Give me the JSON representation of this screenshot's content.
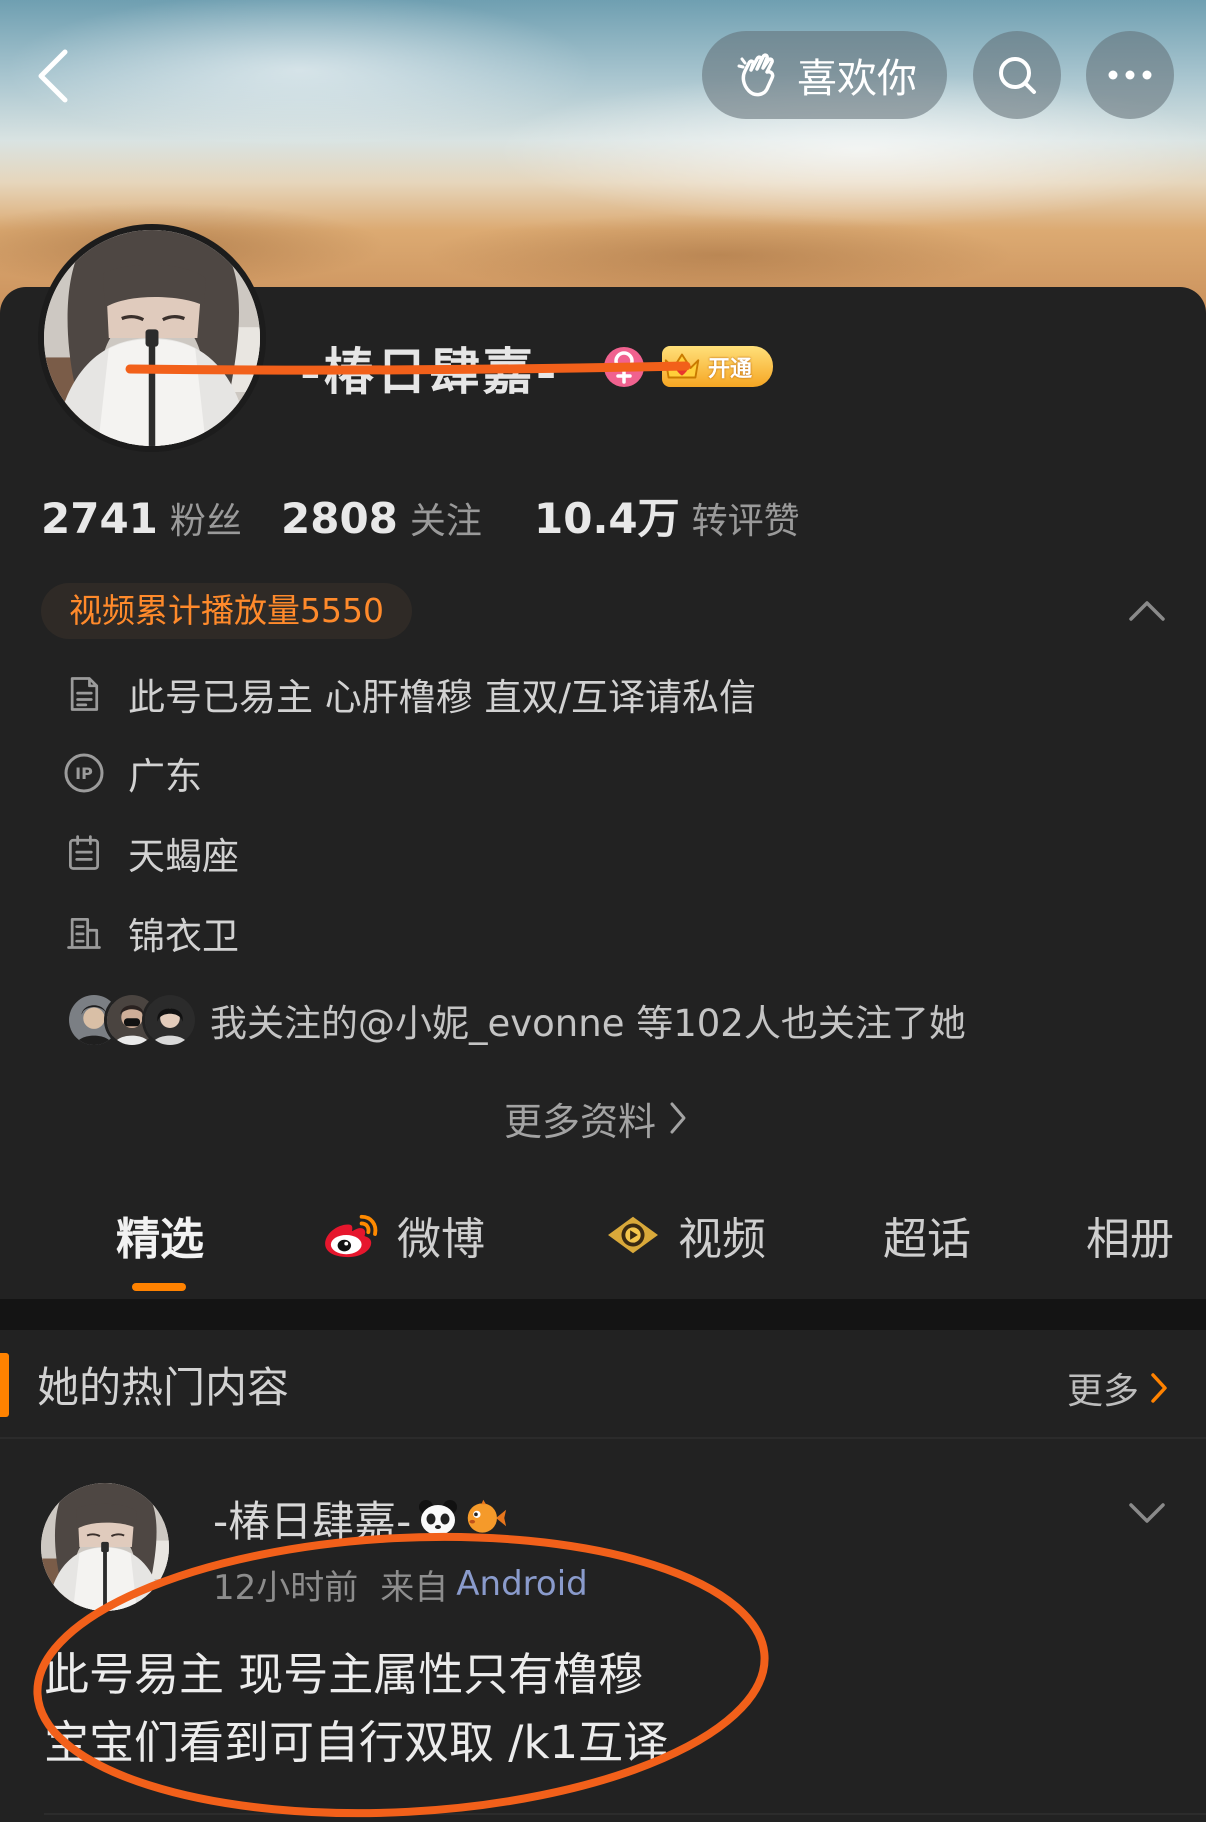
{
  "colors": {
    "accent": "#ff8200",
    "background": "#222222",
    "video_plays_text": "#ff8a2b",
    "source_link": "#8a9bcc",
    "annotation": "#f2601a"
  },
  "header": {
    "back_icon": "chevron-left-icon",
    "like_button": {
      "icon": "clap-hand-icon",
      "label": "喜欢你"
    },
    "search_icon": "search-icon",
    "more_icon": "more-dots-icon"
  },
  "profile": {
    "name": "-椿日肆嘉-",
    "gender_icon": "female-icon",
    "vip_badge": {
      "icon": "crown-icon",
      "label": "开通"
    },
    "stats": [
      {
        "value": "2741",
        "label": "粉丝"
      },
      {
        "value": "2808",
        "label": "关注"
      },
      {
        "value": "10.4万",
        "label": "转评赞"
      }
    ],
    "video_plays": "视频累计播放量5550",
    "info": [
      {
        "icon": "document-icon",
        "text": "此号已易主 心肝橹穆 直双/互译请私信"
      },
      {
        "icon": "ip-icon",
        "icon_text": "IP",
        "text": "广东"
      },
      {
        "icon": "calendar-icon",
        "text": "天蝎座"
      },
      {
        "icon": "company-icon",
        "text": "锦衣卫"
      }
    ],
    "mutual_follow": "我关注的@小妮_evonne 等102人也关注了她",
    "more_info": "更多资料"
  },
  "tabs": [
    {
      "label": "精选",
      "selected": true
    },
    {
      "label": "微博",
      "icon": "weibo-logo-icon"
    },
    {
      "label": "视频",
      "icon": "video-channel-icon"
    },
    {
      "label": "超话"
    },
    {
      "label": "相册"
    }
  ],
  "hot_section": {
    "title": "她的热门内容",
    "more": "更多"
  },
  "post": {
    "author": "-椿日肆嘉-",
    "author_emojis": [
      "panda-emoji-icon",
      "pufferfish-emoji-icon"
    ],
    "time": "12小时前",
    "source_prefix": "来自",
    "source": "Android",
    "text_lines": [
      "此号易主 现号主属性只有橹穆",
      "宝宝们看到可自行双取 /k1互译"
    ]
  }
}
